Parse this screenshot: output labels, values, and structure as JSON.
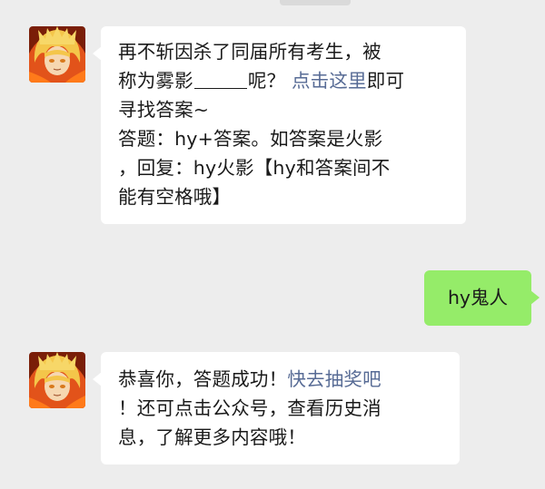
{
  "colors": {
    "background": "#ededed",
    "incoming_bubble": "#ffffff",
    "outgoing_bubble": "#95ec69",
    "link": "#576b95"
  },
  "messages": [
    {
      "direction": "incoming",
      "avatar_icon": "anime-character-avatar-icon",
      "lines": {
        "l1": "再不斩因杀了同届所有考生，被",
        "l2a": "称为雾影",
        "l2b": "呢？",
        "l2_link": "点击这里",
        "l2c": "即可",
        "l3": "寻找答案~",
        "l4": "答题：hy+答案。如答案是火影",
        "l5": "，回复：hy火影【hy和答案间不",
        "l6": "能有空格哦】"
      }
    },
    {
      "direction": "outgoing",
      "text": "hy鬼人"
    },
    {
      "direction": "incoming",
      "avatar_icon": "anime-character-avatar-icon",
      "lines": {
        "l1a": "恭喜你，答题成功！",
        "l1_link": "快去抽奖吧",
        "l2": "！还可点击公众号，查看历史消",
        "l3": "息，了解更多内容哦！"
      }
    }
  ]
}
